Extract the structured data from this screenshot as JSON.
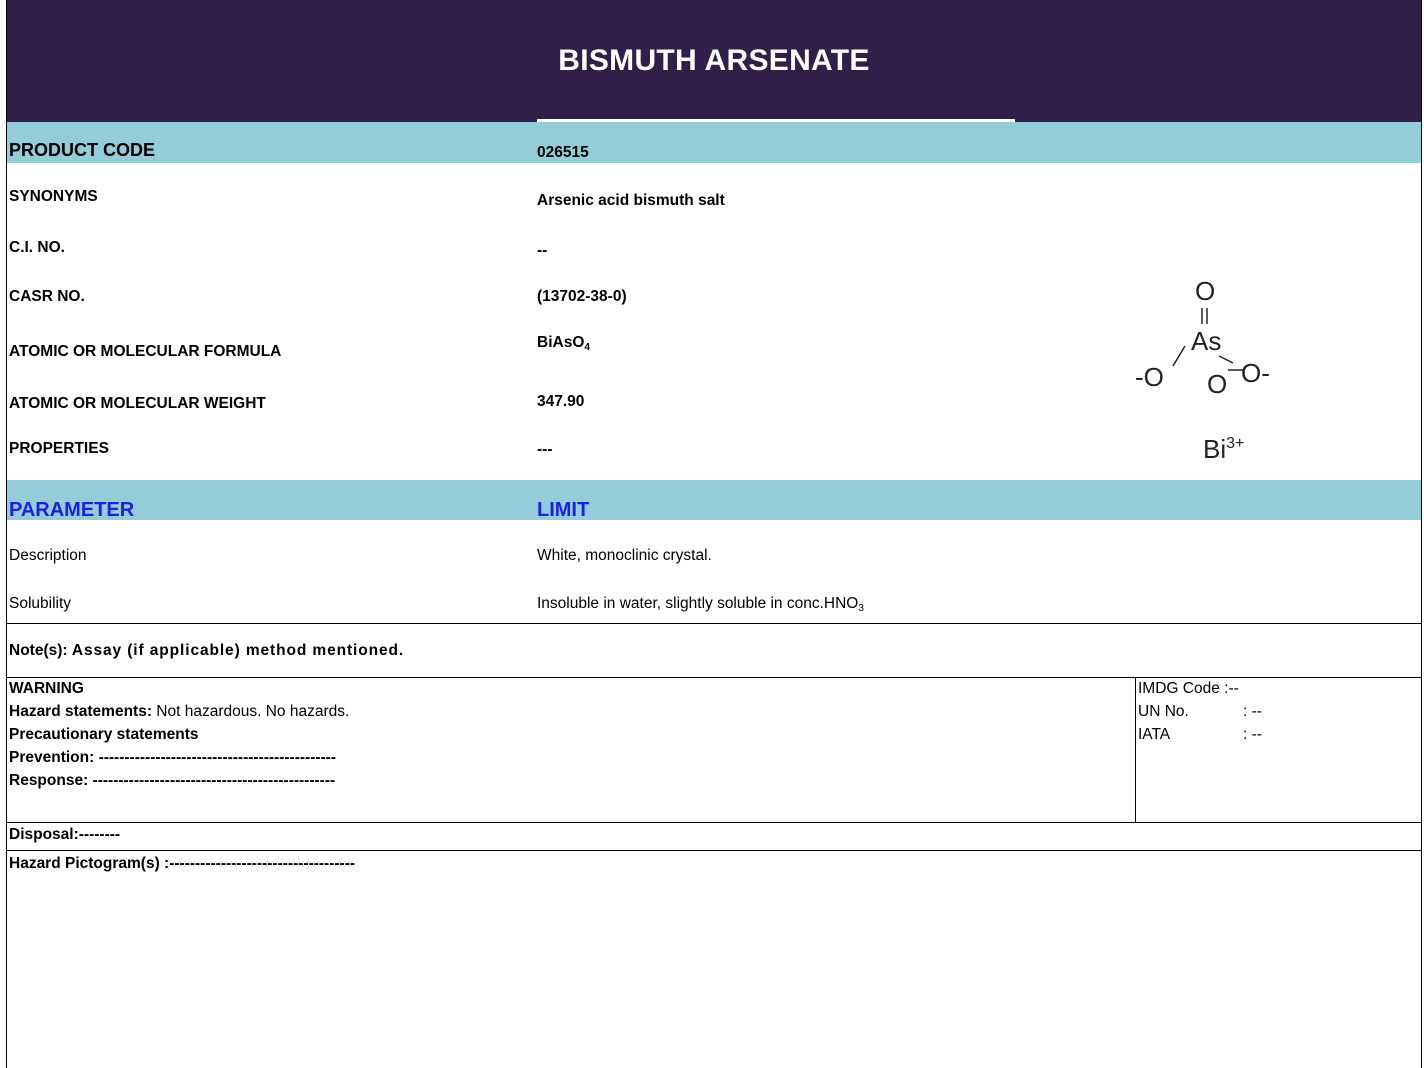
{
  "title": "BISMUTH ARSENATE",
  "info": {
    "product_code_label": "PRODUCT CODE",
    "product_code_value": "026515",
    "synonyms_label": "SYNONYMS",
    "synonyms_value": "Arsenic acid bismuth salt",
    "ci_label": "C.I. NO.",
    "ci_value": "--",
    "casr_label": "CASR NO.",
    "casr_value": "(13702-38-0)",
    "formula_label": "ATOMIC OR MOLECULAR FORMULA",
    "formula_main": "BiAsO",
    "formula_sub": "4",
    "weight_label": "ATOMIC OR MOLECULAR WEIGHT",
    "weight_value": "347.90",
    "properties_label": "PROPERTIES",
    "properties_value": "---"
  },
  "structure": {
    "o_top": "O",
    "as": "As",
    "o_left": "-O",
    "o_mid": "O",
    "o_right": "O-",
    "bi": "Bi",
    "bi_charge": "3+"
  },
  "spec": {
    "param_header": "PARAMETER",
    "limit_header": "LIMIT",
    "rows": [
      {
        "param": "Description",
        "limit": "White, monoclinic crystal."
      },
      {
        "param": "Solubility",
        "limit": "Insoluble in water, slightly soluble in conc.HNO",
        "limit_sub": "3"
      }
    ]
  },
  "note": {
    "prefix": "Note(s): ",
    "text": "Assay (if applicable) method mentioned."
  },
  "safety": {
    "warning": "WARNING",
    "hazard_label": "Hazard statements:",
    "hazard_text": " Not hazardous. No hazards.",
    "precautionary": "Precautionary statements",
    "prevention": "Prevention: ----------------------------------------------",
    "response": "Response: -----------------------------------------------",
    "imdg_label": "IMDG Code :",
    "imdg_value": "--",
    "un_label": "UN No.",
    "un_value": ":  --",
    "iata_label": "IATA",
    "iata_value": ":  --"
  },
  "disposal": "Disposal:--------",
  "pictogram": "Hazard Pictogram(s) :------------------------------------"
}
